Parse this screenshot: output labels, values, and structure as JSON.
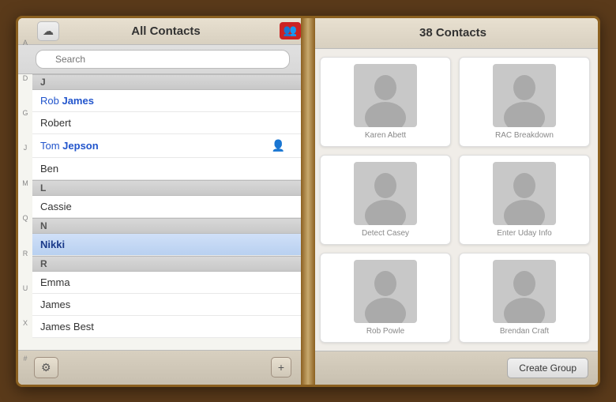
{
  "book": {
    "left_page": {
      "title": "All Contacts",
      "cloud_icon": "☁",
      "group_icon": "👥",
      "search_placeholder": "Search",
      "alphabet": [
        "A",
        "D",
        "G",
        "J",
        "M",
        "Q",
        "R",
        "U",
        "X",
        "#"
      ],
      "contacts": [
        {
          "type": "section",
          "label": "J"
        },
        {
          "type": "item",
          "name": "Rob James",
          "bold_last": false,
          "has_icon": false
        },
        {
          "type": "item",
          "name": "Robert",
          "bold_last": false,
          "has_icon": false
        },
        {
          "type": "item",
          "name": "Tom Jepson",
          "bold_last": true,
          "has_icon": true,
          "selected": false
        },
        {
          "type": "item",
          "name": "Ben",
          "bold_last": false,
          "has_icon": false
        },
        {
          "type": "section",
          "label": "L"
        },
        {
          "type": "item",
          "name": "Cassie",
          "bold_last": false,
          "has_icon": false
        },
        {
          "type": "section",
          "label": "N"
        },
        {
          "type": "item",
          "name": "Nikki",
          "bold_last": false,
          "has_icon": false,
          "selected": true
        },
        {
          "type": "section",
          "label": "R"
        },
        {
          "type": "item",
          "name": "Emma",
          "bold_last": false,
          "has_icon": false
        },
        {
          "type": "item",
          "name": "James",
          "bold_last": false,
          "has_icon": false
        },
        {
          "type": "item",
          "name": "James Best",
          "bold_last": false,
          "has_icon": false
        }
      ],
      "footer": {
        "settings_icon": "⚙",
        "add_icon": "+"
      }
    },
    "right_page": {
      "title": "38 Contacts",
      "contacts": [
        {
          "name": "Karen Abett"
        },
        {
          "name": "RAC Breakdown"
        },
        {
          "name": "Detect Casey"
        },
        {
          "name": "Enter Uday Info"
        },
        {
          "name": "Rob Powle"
        },
        {
          "name": "Brendan Craft"
        }
      ],
      "footer": {
        "create_group_label": "Create Group"
      }
    }
  }
}
